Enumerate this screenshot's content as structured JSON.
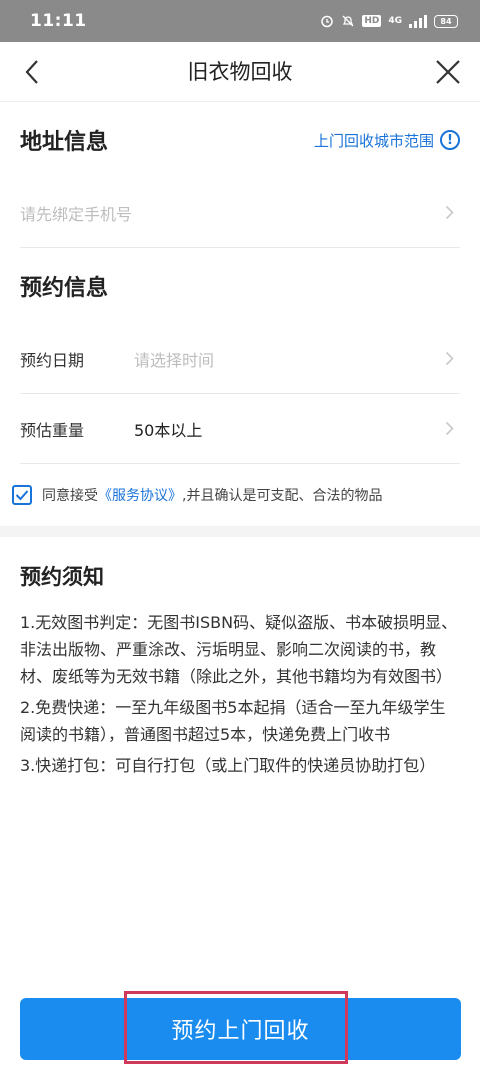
{
  "status_bar": {
    "time": "11:11",
    "network": "4G",
    "hd": "HD",
    "battery": "84"
  },
  "nav": {
    "title": "旧衣物回收"
  },
  "address": {
    "title": "地址信息",
    "range_link": "上门回收城市范围",
    "phone_placeholder": "请先绑定手机号"
  },
  "booking": {
    "title": "预约信息",
    "date_label": "预约日期",
    "date_placeholder": "请选择时间",
    "weight_label": "预估重量",
    "weight_value": "50本以上"
  },
  "agreement": {
    "prefix": "同意接受",
    "link": "《服务协议》",
    "suffix": ",并且确认是可支配、合法的物品",
    "checked": true
  },
  "notice": {
    "title": "预约须知",
    "items": [
      "1.无效图书判定：无图书ISBN码、疑似盗版、书本破损明显、非法出版物、严重涂改、污垢明显、影响二次阅读的书，教材、废纸等为无效书籍（除此之外，其他书籍均为有效图书）",
      "2.免费快递：一至九年级图书5本起捐（适合一至九年级学生阅读的书籍），普通图书超过5本，快递免费上门收书",
      "3.快递打包：可自行打包（或上门取件的快递员协助打包）"
    ]
  },
  "submit": {
    "label": "预约上门回收"
  },
  "colors": {
    "accent": "#1a73d9",
    "button": "#1a8cf0",
    "highlight": "#d03a5a"
  }
}
